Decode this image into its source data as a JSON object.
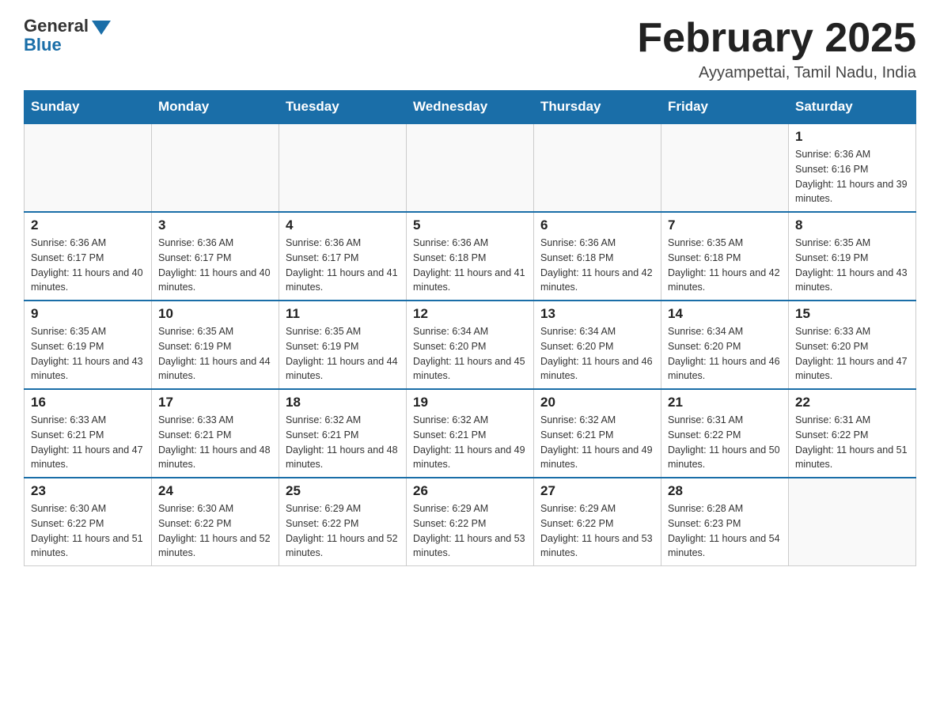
{
  "header": {
    "logo_general": "General",
    "logo_blue": "Blue",
    "month_title": "February 2025",
    "location": "Ayyampettai, Tamil Nadu, India"
  },
  "days_of_week": [
    "Sunday",
    "Monday",
    "Tuesday",
    "Wednesday",
    "Thursday",
    "Friday",
    "Saturday"
  ],
  "weeks": [
    [
      {
        "day": "",
        "info": ""
      },
      {
        "day": "",
        "info": ""
      },
      {
        "day": "",
        "info": ""
      },
      {
        "day": "",
        "info": ""
      },
      {
        "day": "",
        "info": ""
      },
      {
        "day": "",
        "info": ""
      },
      {
        "day": "1",
        "info": "Sunrise: 6:36 AM\nSunset: 6:16 PM\nDaylight: 11 hours and 39 minutes."
      }
    ],
    [
      {
        "day": "2",
        "info": "Sunrise: 6:36 AM\nSunset: 6:17 PM\nDaylight: 11 hours and 40 minutes."
      },
      {
        "day": "3",
        "info": "Sunrise: 6:36 AM\nSunset: 6:17 PM\nDaylight: 11 hours and 40 minutes."
      },
      {
        "day": "4",
        "info": "Sunrise: 6:36 AM\nSunset: 6:17 PM\nDaylight: 11 hours and 41 minutes."
      },
      {
        "day": "5",
        "info": "Sunrise: 6:36 AM\nSunset: 6:18 PM\nDaylight: 11 hours and 41 minutes."
      },
      {
        "day": "6",
        "info": "Sunrise: 6:36 AM\nSunset: 6:18 PM\nDaylight: 11 hours and 42 minutes."
      },
      {
        "day": "7",
        "info": "Sunrise: 6:35 AM\nSunset: 6:18 PM\nDaylight: 11 hours and 42 minutes."
      },
      {
        "day": "8",
        "info": "Sunrise: 6:35 AM\nSunset: 6:19 PM\nDaylight: 11 hours and 43 minutes."
      }
    ],
    [
      {
        "day": "9",
        "info": "Sunrise: 6:35 AM\nSunset: 6:19 PM\nDaylight: 11 hours and 43 minutes."
      },
      {
        "day": "10",
        "info": "Sunrise: 6:35 AM\nSunset: 6:19 PM\nDaylight: 11 hours and 44 minutes."
      },
      {
        "day": "11",
        "info": "Sunrise: 6:35 AM\nSunset: 6:19 PM\nDaylight: 11 hours and 44 minutes."
      },
      {
        "day": "12",
        "info": "Sunrise: 6:34 AM\nSunset: 6:20 PM\nDaylight: 11 hours and 45 minutes."
      },
      {
        "day": "13",
        "info": "Sunrise: 6:34 AM\nSunset: 6:20 PM\nDaylight: 11 hours and 46 minutes."
      },
      {
        "day": "14",
        "info": "Sunrise: 6:34 AM\nSunset: 6:20 PM\nDaylight: 11 hours and 46 minutes."
      },
      {
        "day": "15",
        "info": "Sunrise: 6:33 AM\nSunset: 6:20 PM\nDaylight: 11 hours and 47 minutes."
      }
    ],
    [
      {
        "day": "16",
        "info": "Sunrise: 6:33 AM\nSunset: 6:21 PM\nDaylight: 11 hours and 47 minutes."
      },
      {
        "day": "17",
        "info": "Sunrise: 6:33 AM\nSunset: 6:21 PM\nDaylight: 11 hours and 48 minutes."
      },
      {
        "day": "18",
        "info": "Sunrise: 6:32 AM\nSunset: 6:21 PM\nDaylight: 11 hours and 48 minutes."
      },
      {
        "day": "19",
        "info": "Sunrise: 6:32 AM\nSunset: 6:21 PM\nDaylight: 11 hours and 49 minutes."
      },
      {
        "day": "20",
        "info": "Sunrise: 6:32 AM\nSunset: 6:21 PM\nDaylight: 11 hours and 49 minutes."
      },
      {
        "day": "21",
        "info": "Sunrise: 6:31 AM\nSunset: 6:22 PM\nDaylight: 11 hours and 50 minutes."
      },
      {
        "day": "22",
        "info": "Sunrise: 6:31 AM\nSunset: 6:22 PM\nDaylight: 11 hours and 51 minutes."
      }
    ],
    [
      {
        "day": "23",
        "info": "Sunrise: 6:30 AM\nSunset: 6:22 PM\nDaylight: 11 hours and 51 minutes."
      },
      {
        "day": "24",
        "info": "Sunrise: 6:30 AM\nSunset: 6:22 PM\nDaylight: 11 hours and 52 minutes."
      },
      {
        "day": "25",
        "info": "Sunrise: 6:29 AM\nSunset: 6:22 PM\nDaylight: 11 hours and 52 minutes."
      },
      {
        "day": "26",
        "info": "Sunrise: 6:29 AM\nSunset: 6:22 PM\nDaylight: 11 hours and 53 minutes."
      },
      {
        "day": "27",
        "info": "Sunrise: 6:29 AM\nSunset: 6:22 PM\nDaylight: 11 hours and 53 minutes."
      },
      {
        "day": "28",
        "info": "Sunrise: 6:28 AM\nSunset: 6:23 PM\nDaylight: 11 hours and 54 minutes."
      },
      {
        "day": "",
        "info": ""
      }
    ]
  ]
}
